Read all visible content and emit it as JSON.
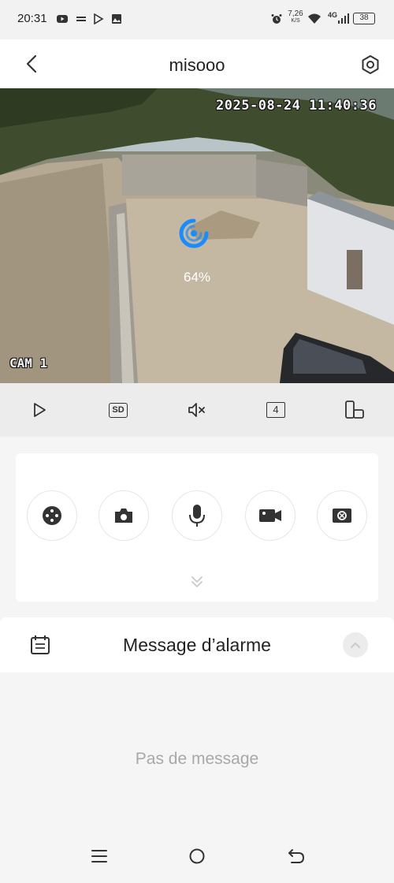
{
  "status_bar": {
    "time": "20:31",
    "speed_value": "7,26",
    "speed_unit": "K/S",
    "network": "4G",
    "battery": "38"
  },
  "header": {
    "title": "misooo"
  },
  "video": {
    "timestamp": "2025-08-24 11:40:36",
    "camera_label": "CAM 1",
    "loading_percent": "64%"
  },
  "controls": {
    "quality_label": "SD",
    "channel_count": "4"
  },
  "actions": {
    "items": [
      "ptz-icon",
      "snapshot-icon",
      "microphone-icon",
      "record-icon",
      "zoom-icon"
    ]
  },
  "alarm": {
    "title": "Message d’alarme",
    "empty_text": "Pas de message"
  },
  "colors": {
    "accent": "#1a8cff",
    "icon_dark": "#333333"
  }
}
